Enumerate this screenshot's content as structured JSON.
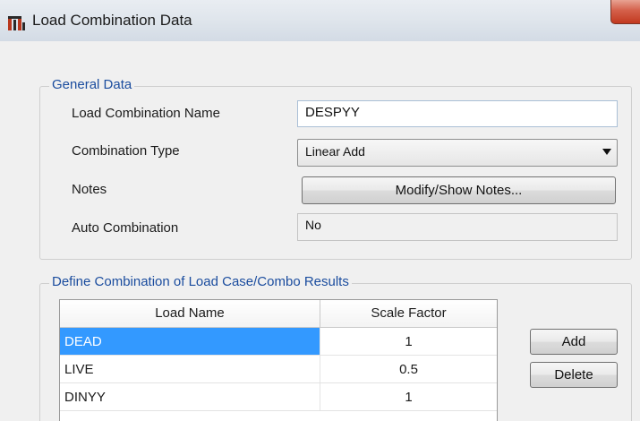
{
  "window": {
    "title": "Load Combination Data"
  },
  "general_data": {
    "title": "General Data",
    "combo_name_label": "Load Combination Name",
    "combo_name_value": "DESPYY",
    "combo_type_label": "Combination Type",
    "combo_type_value": "Linear Add",
    "notes_label": "Notes",
    "notes_button": "Modify/Show Notes...",
    "auto_combo_label": "Auto Combination",
    "auto_combo_value": "No"
  },
  "define_combination": {
    "title": "Define Combination of Load Case/Combo Results",
    "columns": [
      "Load Name",
      "Scale Factor"
    ],
    "rows": [
      {
        "name": "DEAD",
        "factor": "1",
        "selected": true
      },
      {
        "name": "LIVE",
        "factor": "0.5",
        "selected": false
      },
      {
        "name": "DINYY",
        "factor": "1",
        "selected": false
      }
    ],
    "add_button": "Add",
    "delete_button": "Delete"
  }
}
